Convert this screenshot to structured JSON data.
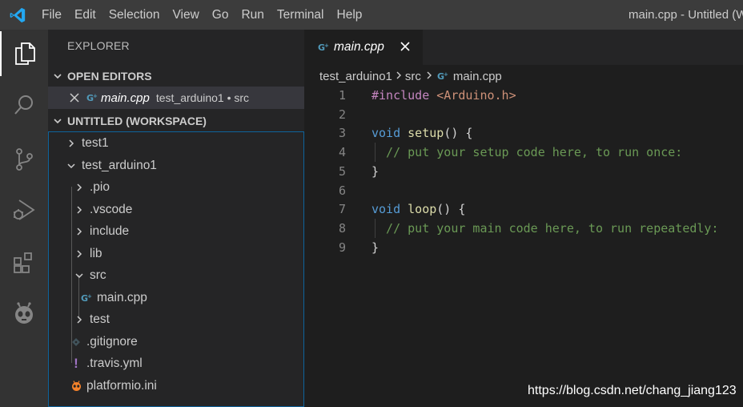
{
  "titlebar": {
    "menu": [
      "File",
      "Edit",
      "Selection",
      "View",
      "Go",
      "Run",
      "Terminal",
      "Help"
    ],
    "window_title": "main.cpp - Untitled (W"
  },
  "activity_bar": {
    "items": [
      "explorer-icon",
      "search-icon",
      "source-control-icon",
      "run-debug-icon",
      "extensions-icon",
      "platformio-icon"
    ]
  },
  "sidebar": {
    "title": "EXPLORER",
    "open_editors": {
      "header": "OPEN EDITORS",
      "items": [
        {
          "name": "main.cpp",
          "path": "test_arduino1 • src"
        }
      ]
    },
    "workspace": {
      "header": "UNTITLED (WORKSPACE)",
      "tree": [
        {
          "label": "test1",
          "type": "folder",
          "expanded": false
        },
        {
          "label": "test_arduino1",
          "type": "folder",
          "expanded": true
        },
        {
          "label": ".pio",
          "type": "folder",
          "expanded": false
        },
        {
          "label": ".vscode",
          "type": "folder",
          "expanded": false
        },
        {
          "label": "include",
          "type": "folder",
          "expanded": false
        },
        {
          "label": "lib",
          "type": "folder",
          "expanded": false
        },
        {
          "label": "src",
          "type": "folder",
          "expanded": true
        },
        {
          "label": "main.cpp",
          "type": "file-cpp"
        },
        {
          "label": "test",
          "type": "folder",
          "expanded": false
        },
        {
          "label": ".gitignore",
          "type": "file-git"
        },
        {
          "label": ".travis.yml",
          "type": "file-yml"
        },
        {
          "label": "platformio.ini",
          "type": "file-ini"
        }
      ]
    }
  },
  "editor": {
    "tab": {
      "label": "main.cpp",
      "icon": "cpp-file-icon"
    },
    "breadcrumb": [
      "test_arduino1",
      "src",
      "main.cpp"
    ],
    "lines": [
      {
        "n": "1",
        "tokens": [
          {
            "t": "#include ",
            "c": "pp"
          },
          {
            "t": "<Arduino.h>",
            "c": "str"
          }
        ]
      },
      {
        "n": "2",
        "tokens": []
      },
      {
        "n": "3",
        "tokens": [
          {
            "t": "void ",
            "c": "kw"
          },
          {
            "t": "setup",
            "c": "fn"
          },
          {
            "t": "() {",
            "c": "pl"
          }
        ]
      },
      {
        "n": "4",
        "tokens": [
          {
            "t": "  // put your setup code here, to run once:",
            "c": "cm"
          }
        ]
      },
      {
        "n": "5",
        "tokens": [
          {
            "t": "}",
            "c": "pl"
          }
        ]
      },
      {
        "n": "6",
        "tokens": []
      },
      {
        "n": "7",
        "tokens": [
          {
            "t": "void ",
            "c": "kw"
          },
          {
            "t": "loop",
            "c": "fn"
          },
          {
            "t": "() {",
            "c": "pl"
          }
        ]
      },
      {
        "n": "8",
        "tokens": [
          {
            "t": "  // put your main code here, to run repeatedly:",
            "c": "cm"
          }
        ]
      },
      {
        "n": "9",
        "tokens": [
          {
            "t": "}",
            "c": "pl"
          }
        ]
      }
    ]
  },
  "watermark": "https://blog.csdn.net/chang_jiang123",
  "colors": {
    "accent": "#0e639c",
    "cpp_icon": "#519aba",
    "platformio": "#f5822a",
    "yml": "#a074c4"
  }
}
